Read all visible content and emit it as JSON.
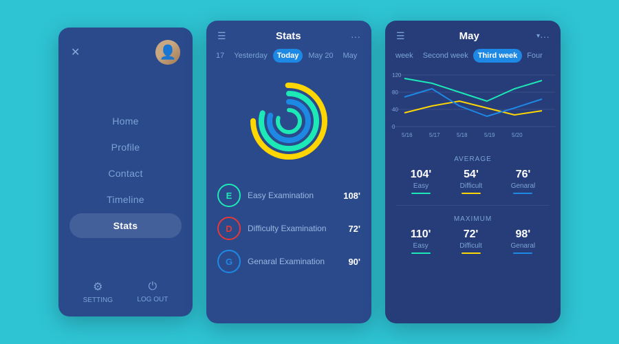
{
  "panel1": {
    "close_label": "✕",
    "menu_items": [
      {
        "label": "Home",
        "active": false
      },
      {
        "label": "Profile",
        "active": false
      },
      {
        "label": "Contact",
        "active": false
      },
      {
        "label": "Timeline",
        "active": false
      },
      {
        "label": "Stats",
        "active": true
      }
    ],
    "footer": [
      {
        "label": "SETTING",
        "icon": "⚙"
      },
      {
        "label": "LOG OUT",
        "icon": "⏻"
      }
    ]
  },
  "panel2": {
    "title": "Stats",
    "tabs": [
      {
        "label": "17",
        "active": false
      },
      {
        "label": "Yesterday",
        "active": false
      },
      {
        "label": "Today",
        "active": true
      },
      {
        "label": "May 20",
        "active": false
      },
      {
        "label": "May",
        "active": false
      }
    ],
    "exams": [
      {
        "badge": "E",
        "label": "Easy Examination",
        "value": "108'",
        "type": "e"
      },
      {
        "badge": "D",
        "label": "Difficulty Examination",
        "value": "72'",
        "type": "d"
      },
      {
        "badge": "G",
        "label": "Genaral Examination",
        "value": "90'",
        "type": "g"
      }
    ]
  },
  "panel3": {
    "title": "May",
    "week_tabs": [
      {
        "label": "week",
        "active": false
      },
      {
        "label": "Second week",
        "active": false
      },
      {
        "label": "Third week",
        "active": true
      },
      {
        "label": "Four",
        "active": false
      }
    ],
    "chart_labels": [
      "5/16",
      "5/17",
      "5/18",
      "5/19",
      "5/20"
    ],
    "chart_y": [
      "120",
      "80",
      "40",
      "0"
    ],
    "average": {
      "label": "AVERAGE",
      "items": [
        {
          "value": "104'",
          "name": "Easy",
          "line": "green"
        },
        {
          "value": "54'",
          "name": "Difficult",
          "line": "yellow"
        },
        {
          "value": "76'",
          "name": "Genaral",
          "line": "blue"
        }
      ]
    },
    "maximum": {
      "label": "MAXIMUM",
      "items": [
        {
          "value": "110'",
          "name": "Easy",
          "line": "green"
        },
        {
          "value": "72'",
          "name": "Difficult",
          "line": "yellow"
        },
        {
          "value": "98'",
          "name": "Genaral",
          "line": "blue"
        }
      ]
    }
  }
}
